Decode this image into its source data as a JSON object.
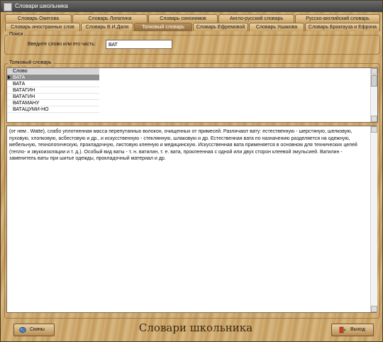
{
  "window": {
    "title": "Словари школьника"
  },
  "tabs_row1": [
    "Словарь Ожегова",
    "Словарь Лопатина",
    "Словарь синонимов",
    "Англо-русский словарь",
    "Русско-английский словарь"
  ],
  "tabs_row2": [
    "Словарь иностранных слов",
    "Словарь В.И.Даля",
    "Толковый словарь",
    "Словарь Ефремовой",
    "Словарь Ушакова",
    "Словарь Брокгауза и Ефрона"
  ],
  "search": {
    "group_label": "Поиск",
    "label": "Введите слово или его часть:",
    "value": "ВАТ"
  },
  "dictionary": {
    "group_label": "Толковый словарь",
    "column_header": "Слово",
    "rows": [
      "ВАТА",
      "ВАТА",
      "ВАТАГИН",
      "ВАТАГИН",
      "ВАТАМАНУ",
      "ВАТАЦУМИ-НО"
    ],
    "selected_index": 0
  },
  "definition": "(от нем . Watte), слабо уплотненная масса перепутанных волокон, очищенных от примесей. Различают вату: естественную - шерстяную, шелковую, пуховую, хлопковую, асбестовую и др., и искусственную - стеклянную, шлаковую и др. Естественная вата по назначению разделяется на одежную, мебельную, технологическую, прокладочную, листовую клееную и медицинскую. Искусственная вата применяется в основном для технических целей (тепло- и звукоизоляции и т. д.). Особый вид ваты - т. н. ватилин, т. е. вата, проклеенная с одной или двух сторон клеевой эмульсией. Ватилин - заменитель ваты при шитье одежды, прокладочный материал и др.",
  "footer": {
    "skins_label": "Скины",
    "title": "Словари школьника",
    "exit_label": "Выход"
  },
  "icons": {
    "skins": "palette-icon",
    "exit": "exit-door-icon"
  }
}
